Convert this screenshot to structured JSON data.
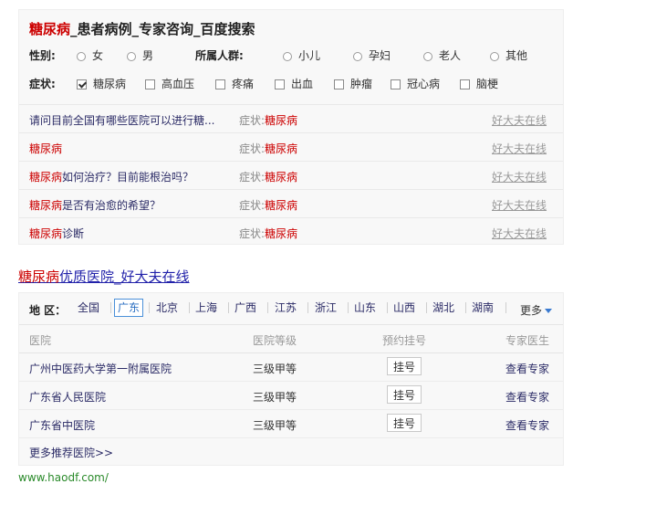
{
  "consult": {
    "title_highlight": "糖尿病",
    "title_rest": "_患者病例_专家咨询_百度搜索",
    "gender_label": "性别:",
    "gender_options": [
      "女",
      "男"
    ],
    "group_label": "所属人群:",
    "group_options": [
      "小儿",
      "孕妇",
      "老人",
      "其他"
    ],
    "symptom_label": "症状:",
    "symptom_options": [
      "糖尿病",
      "高血压",
      "疼痛",
      "出血",
      "肿瘤",
      "冠心病",
      "脑梗"
    ],
    "symptom_checked": "糖尿病",
    "rows": [
      {
        "q_hl": "",
        "q_text": "请问目前全国有哪些医院可以进行糖...",
        "sym_label": "症状:",
        "sym": "糖尿病",
        "src": "好大夫在线"
      },
      {
        "q_hl": "糖尿病",
        "q_text": "",
        "sym_label": "症状:",
        "sym": "糖尿病",
        "src": "好大夫在线"
      },
      {
        "q_hl": "糖尿病",
        "q_text": "如何治疗？目前能根治吗？",
        "sym_label": "症状:",
        "sym": "糖尿病",
        "src": "好大夫在线"
      },
      {
        "q_hl": "糖尿病",
        "q_text": "是否有治愈的希望？",
        "sym_label": "症状:",
        "sym": "糖尿病",
        "src": "好大夫在线"
      },
      {
        "q_hl": "糖尿病",
        "q_text": "诊断",
        "sym_label": "症状:",
        "sym": "糖尿病",
        "src": "好大夫在线"
      }
    ]
  },
  "hospitals": {
    "title_highlight": "糖尿病",
    "title_rest": "优质医院_好大夫在线",
    "region_label": "地  区：",
    "regions": [
      "全国",
      "广东",
      "北京",
      "上海",
      "广西",
      "江苏",
      "浙江",
      "山东",
      "山西",
      "湖北",
      "湖南"
    ],
    "active_region": "广东",
    "more": "更多",
    "columns": [
      "医院",
      "医院等级",
      "预约挂号",
      "专家医生"
    ],
    "rows": [
      {
        "name": "广州中医药大学第一附属医院",
        "grade": "三级甲等",
        "action": "挂号",
        "expert": "查看专家"
      },
      {
        "name": "广东省人民医院",
        "grade": "三级甲等",
        "action": "挂号",
        "expert": "查看专家"
      },
      {
        "name": "广东省中医院",
        "grade": "三级甲等",
        "action": "挂号",
        "expert": "查看专家"
      }
    ],
    "more_link": "更多推荐医院>>"
  },
  "footer_url": "www.haodf.com/",
  "colors": {
    "highlight": "#cc0000",
    "link": "#2b2b66",
    "url": "#2a8a2a",
    "active_border": "#4a90d9"
  }
}
